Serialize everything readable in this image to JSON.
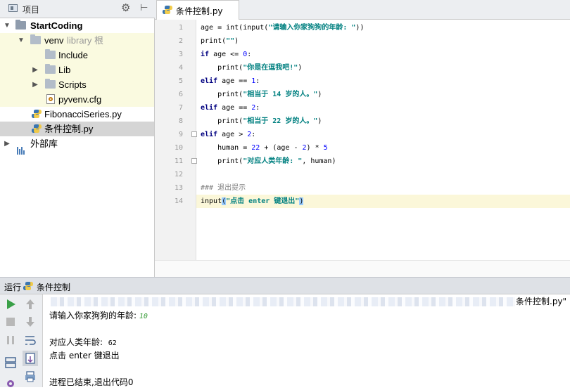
{
  "project_panel": {
    "title": "项目",
    "tree": [
      {
        "label": "StartCoding",
        "icon": "folder-icon",
        "expanded": true
      },
      {
        "label": "venv",
        "suffix": "library 根",
        "icon": "folder-icon",
        "expanded": true
      },
      {
        "label": "Include",
        "icon": "folder-icon"
      },
      {
        "label": "Lib",
        "icon": "folder-icon",
        "expanded": false
      },
      {
        "label": "Scripts",
        "icon": "folder-icon",
        "expanded": false
      },
      {
        "label": "pyvenv.cfg",
        "icon": "config-file-icon"
      },
      {
        "label": "FibonacciSeries.py",
        "icon": "python-file-icon"
      },
      {
        "label": "条件控制.py",
        "icon": "python-file-icon",
        "selected": true
      },
      {
        "label": "外部库",
        "icon": "external-libraries-icon",
        "expanded": false
      }
    ]
  },
  "editor": {
    "tab": {
      "label": "条件控制.py",
      "icon": "python-file-icon"
    },
    "current_line": 14,
    "line_numbers": [
      "1",
      "2",
      "3",
      "4",
      "5",
      "6",
      "7",
      "8",
      "9",
      "10",
      "11",
      "12",
      "13",
      "14"
    ],
    "lines": [
      "age = int(input(\"请输入你家狗狗的年龄: \"))",
      "print(\"\")",
      "if age <= 0:",
      "    print(\"你是在逗我吧!\")",
      "elif age == 1:",
      "    print(\"相当于 14 岁的人。\")",
      "elif age == 2:",
      "    print(\"相当于 22 岁的人。\")",
      "elif age > 2:",
      "    human = 22 + (age - 2) * 5",
      "    print(\"对应人类年龄: \", human)",
      "",
      "### 退出提示",
      "input(\"点击 enter 键退出\")"
    ]
  },
  "run_panel": {
    "title": "运行",
    "config_name": "条件控制",
    "path_tail": "条件控制.py\"",
    "console": {
      "prompt": "请输入你家狗狗的年龄: ",
      "input_value": "10",
      "output_label": "对应人类年龄:",
      "output_value": "62",
      "exit_hint": "点击 enter 键退出",
      "finished": "进程已结束,退出代码0"
    }
  },
  "colors": {
    "keyword": "#000080",
    "string": "#008080",
    "number": "#0000ff",
    "comment": "#808080",
    "input_echo": "#339933",
    "library_root_bg": "#fafae0",
    "current_line_bg": "#fbf7d9"
  }
}
